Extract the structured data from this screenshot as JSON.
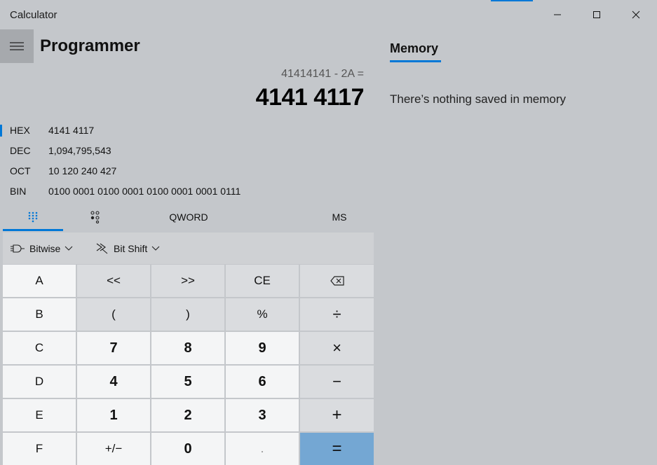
{
  "window": {
    "title": "Calculator",
    "accent_color": "#0078d7"
  },
  "header": {
    "mode_title": "Programmer"
  },
  "display": {
    "expression": "41414141 - 2A =",
    "result": "4141 4117"
  },
  "radix": [
    {
      "name": "HEX",
      "value": "4141 4117",
      "active": true
    },
    {
      "name": "DEC",
      "value": "1,094,795,543",
      "active": false
    },
    {
      "name": "OCT",
      "value": "10 120 240 427",
      "active": false
    },
    {
      "name": "BIN",
      "value": "0100 0001 0100 0001 0100 0001 0001 0111",
      "active": false
    }
  ],
  "tabs": {
    "keypad_icon": "keypad-icon",
    "bit_toggle_icon": "bit-toggle-icon",
    "word_size": "QWORD",
    "memory_store": "MS"
  },
  "toolbar": {
    "bitwise": "Bitwise",
    "bitshift": "Bit Shift"
  },
  "keypad": {
    "row1": [
      "A",
      "<<",
      ">>",
      "CE",
      "⌫"
    ],
    "row2": [
      "B",
      "(",
      ")",
      "%",
      "÷"
    ],
    "row3": [
      "C",
      "7",
      "8",
      "9",
      "×"
    ],
    "row4": [
      "D",
      "4",
      "5",
      "6",
      "−"
    ],
    "row5": [
      "E",
      "1",
      "2",
      "3",
      "+"
    ],
    "row6": [
      "F",
      "+/−",
      "0",
      ".",
      "="
    ]
  },
  "memory": {
    "tab_label": "Memory",
    "empty_text": "There’s nothing saved in memory"
  }
}
